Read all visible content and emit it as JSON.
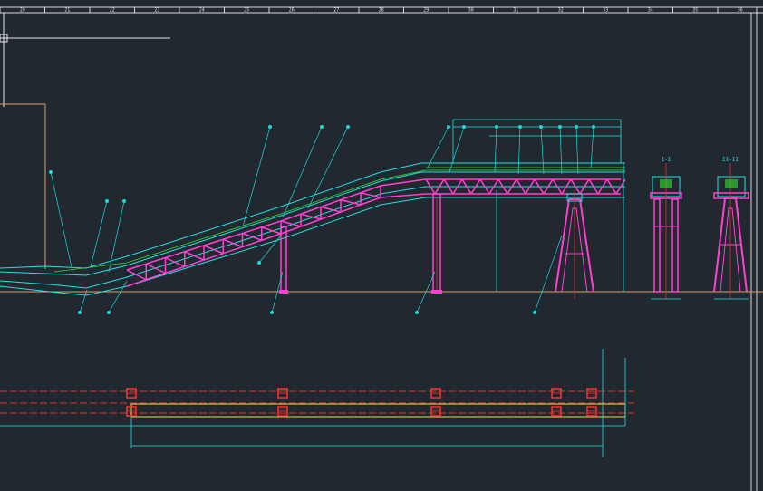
{
  "grid_numbers": [
    "20",
    "21",
    "22",
    "23",
    "24",
    "25",
    "26",
    "27",
    "28",
    "29",
    "30",
    "31",
    "32",
    "33",
    "34",
    "35",
    "36"
  ],
  "section_labels": [
    "I-I",
    "II-II"
  ],
  "colors": {
    "background": "#212830",
    "border": "#e6e6e6",
    "structure_cyan": "#20e0e0",
    "truss_magenta": "#ff40d0",
    "dimension_green": "#30e030",
    "leader_cyan": "#20d8d8",
    "centerline_red": "#e03030",
    "ground_tan": "#e0a060",
    "belt_yellow": "#e0e040",
    "support_box_red": "#ff3030"
  },
  "icons": [
    "crosshair-cursor-icon",
    "ucs-icon"
  ]
}
